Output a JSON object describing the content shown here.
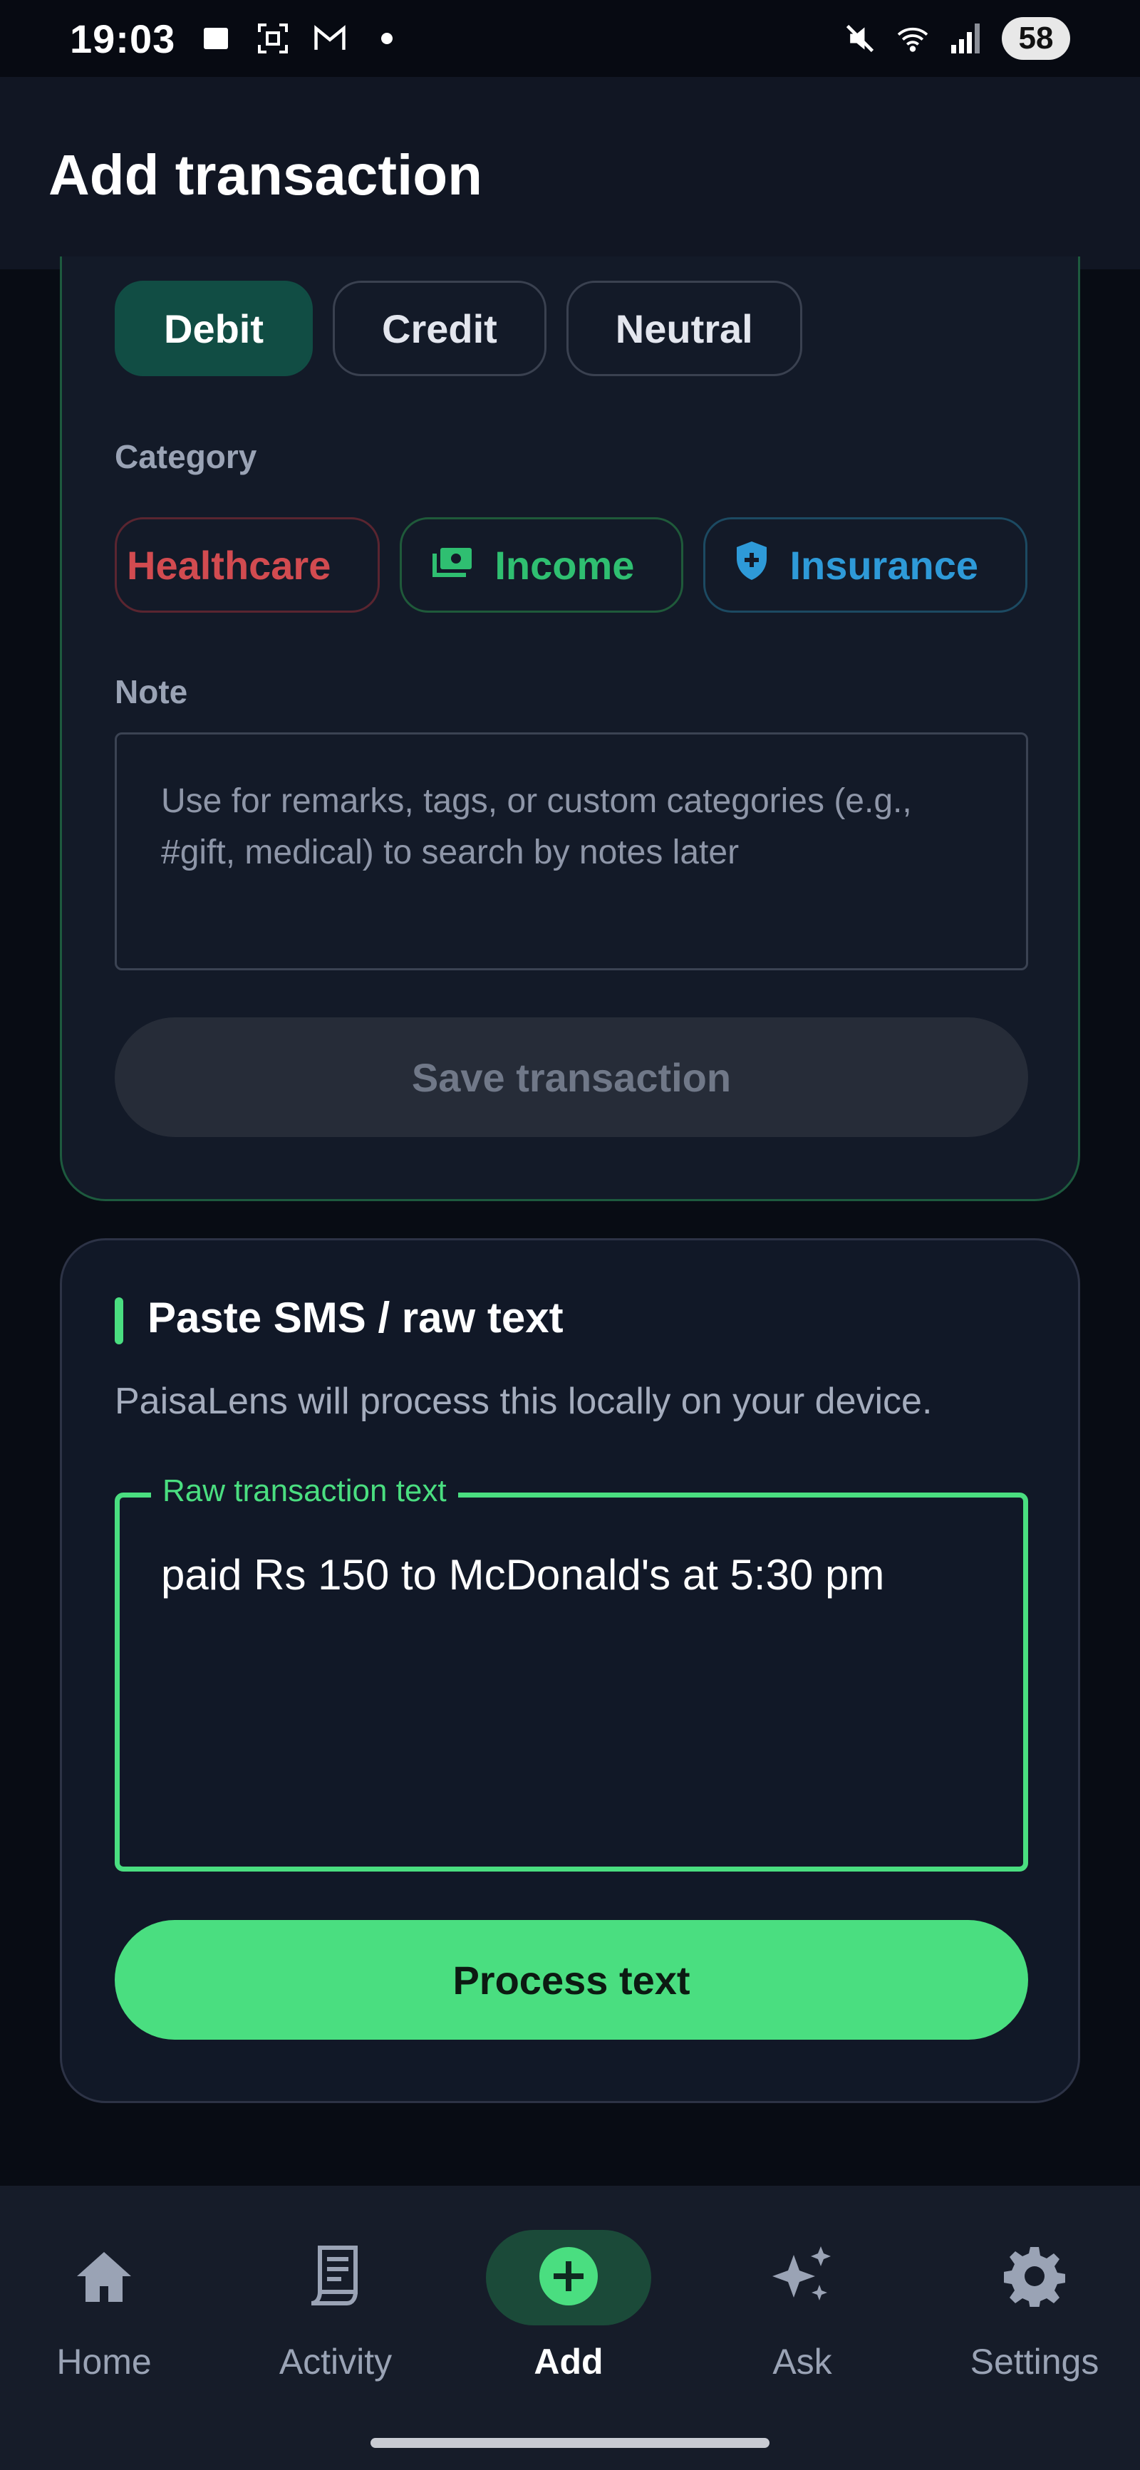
{
  "status_bar": {
    "time": "19:03",
    "battery": "58",
    "icons": [
      "image-icon",
      "screenshot-icon",
      "gmail-icon",
      "dot-icon",
      "mute-icon",
      "wifi-icon",
      "signal-icon"
    ]
  },
  "app_bar": {
    "title": "Add transaction"
  },
  "transaction_form": {
    "type_options": [
      "Debit",
      "Credit",
      "Neutral"
    ],
    "selected_type": "Debit",
    "category_label": "Category",
    "categories": [
      {
        "label": "Healthcare",
        "color": "#d24b50",
        "icon": ""
      },
      {
        "label": "Income",
        "color": "#2fbf71",
        "icon": "cash-icon"
      },
      {
        "label": "Insurance",
        "color": "#2e9ad8",
        "icon": "shield-plus-icon"
      }
    ],
    "note_label": "Note",
    "note_placeholder": "Use for remarks, tags, or custom categories (e.g., #gift, medical) to search by notes later",
    "save_label": "Save transaction"
  },
  "sms_section": {
    "title": "Paste SMS / raw text",
    "subtitle": "PaisaLens will process this locally on your device.",
    "field_label": "Raw transaction text",
    "field_value": "paid Rs 150 to McDonald's at 5:30 pm",
    "process_label": "Process text",
    "accent": "#4ade80"
  },
  "bottom_nav": {
    "items": [
      {
        "label": "Home",
        "icon": "home-icon"
      },
      {
        "label": "Activity",
        "icon": "receipt-icon"
      },
      {
        "label": "Add",
        "icon": "add-circle-icon"
      },
      {
        "label": "Ask",
        "icon": "sparkle-icon"
      },
      {
        "label": "Settings",
        "icon": "gear-icon"
      }
    ],
    "active": "Add"
  }
}
